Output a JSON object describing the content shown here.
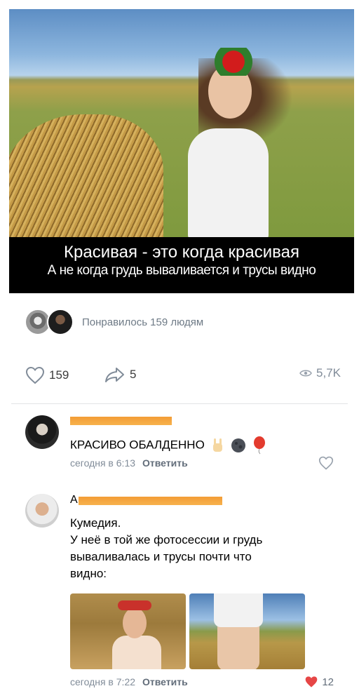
{
  "post": {
    "caption_line1": "Красивая - это когда красивая",
    "caption_line2": "А не когда грудь вываливается и трусы видно",
    "liked_by": "Понравилось 159 людям",
    "likes": "159",
    "shares": "5",
    "views": "5,7K"
  },
  "comments": [
    {
      "text": "КРАСИВО ОБАЛДЕННО",
      "emojis": [
        "rock-hand-emoji",
        "black-moon-emoji",
        "red-balloon-emoji"
      ],
      "time": "сегодня в 6:13",
      "reply": "Ответить"
    },
    {
      "author_initial": "А",
      "lines": [
        "Кумедия.",
        "У неё в той же фотосессии и грудь",
        "вываливалась и трусы почти что",
        "видно:"
      ],
      "time": "сегодня в 7:22",
      "reply": "Ответить",
      "likes": "12"
    }
  ],
  "colors": {
    "heart_liked": "#e64646",
    "meta": "#818c99",
    "redaction": "#f39c35"
  }
}
